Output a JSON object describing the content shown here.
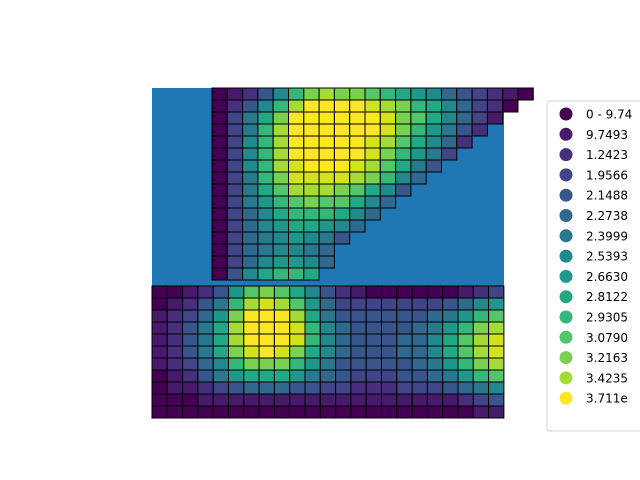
{
  "colors": {
    "background_fill": "#1f77b4",
    "cell_edge": "#000000",
    "palette": [
      "#440154",
      "#481a6c",
      "#472f7d",
      "#414487",
      "#39568c",
      "#31688e",
      "#2a788e",
      "#23888e",
      "#1f988b",
      "#22a884",
      "#35b779",
      "#54c568",
      "#7ad151",
      "#a5db36",
      "#d2e21b",
      "#fde725"
    ]
  },
  "chart_data": {
    "type": "heatmap",
    "title": "",
    "xlabel": "",
    "ylabel": "",
    "grid": false,
    "axes_visible": false,
    "legend_position": "right",
    "legend": [
      {
        "label": "0 - 9.74",
        "class": 0
      },
      {
        "label": "9.7493",
        "class": 1
      },
      {
        "label": "1.2423",
        "class": 2
      },
      {
        "label": "1.9566",
        "class": 3
      },
      {
        "label": "2.1488",
        "class": 4
      },
      {
        "label": "2.2738",
        "class": 5
      },
      {
        "label": "2.3999",
        "class": 6
      },
      {
        "label": "2.5393",
        "class": 7
      },
      {
        "label": "2.6630",
        "class": 8
      },
      {
        "label": "2.8122",
        "class": 9
      },
      {
        "label": "2.9305",
        "class": 10
      },
      {
        "label": "3.0790",
        "class": 11
      },
      {
        "label": "3.2163",
        "class": 12
      },
      {
        "label": "3.4235",
        "class": 13
      },
      {
        "label": "3.711e",
        "class": 15
      }
    ],
    "grid_columns": 23,
    "grid_rows": 20,
    "notes": "Cells are square grid elements colored by class index 0-15; upper wedge occupies columns 4 to right diagonal edge, lower bar spans full width.",
    "upper_rows": [
      [
        0,
        1,
        2,
        4,
        7,
        10,
        12,
        13,
        12,
        12,
        11,
        10,
        9,
        8,
        7,
        5,
        4,
        3,
        2,
        1,
        0
      ],
      [
        0,
        2,
        4,
        7,
        10,
        13,
        15,
        15,
        15,
        15,
        14,
        13,
        12,
        10,
        9,
        7,
        5,
        3,
        2,
        0
      ],
      [
        0,
        3,
        6,
        9,
        12,
        15,
        15,
        15,
        15,
        15,
        15,
        14,
        12,
        11,
        9,
        7,
        5,
        3,
        1
      ],
      [
        0,
        3,
        6,
        10,
        13,
        15,
        15,
        15,
        15,
        15,
        15,
        14,
        12,
        10,
        8,
        6,
        4,
        2
      ],
      [
        0,
        3,
        7,
        10,
        13,
        15,
        15,
        15,
        15,
        15,
        14,
        13,
        11,
        9,
        7,
        5,
        2
      ],
      [
        0,
        3,
        7,
        10,
        13,
        15,
        15,
        15,
        15,
        15,
        14,
        12,
        10,
        8,
        6,
        3
      ],
      [
        0,
        3,
        7,
        10,
        13,
        14,
        15,
        15,
        15,
        14,
        13,
        11,
        9,
        6,
        4
      ],
      [
        0,
        3,
        6,
        10,
        12,
        14,
        14,
        14,
        14,
        13,
        12,
        10,
        7,
        5
      ],
      [
        0,
        3,
        6,
        9,
        11,
        13,
        13,
        13,
        12,
        11,
        9,
        7,
        4
      ],
      [
        0,
        3,
        6,
        8,
        10,
        11,
        12,
        11,
        11,
        9,
        7,
        5
      ],
      [
        0,
        3,
        5,
        7,
        9,
        10,
        10,
        10,
        9,
        7,
        5
      ],
      [
        0,
        3,
        5,
        7,
        8,
        9,
        9,
        8,
        7,
        5
      ],
      [
        0,
        3,
        5,
        6,
        7,
        8,
        7,
        6,
        4
      ],
      [
        0,
        3,
        5,
        6,
        7,
        7,
        6,
        5
      ],
      [
        0,
        3,
        5,
        7,
        8,
        8,
        7,
        5
      ],
      [
        0,
        4,
        7,
        9,
        10,
        10,
        9
      ]
    ],
    "lower_rows": [
      [
        0,
        0,
        1,
        2,
        4,
        8,
        11,
        12,
        11,
        9,
        7,
        4,
        2,
        1,
        0,
        0,
        0,
        0,
        0,
        0,
        1,
        2,
        3
      ],
      [
        0,
        1,
        2,
        4,
        6,
        10,
        13,
        14,
        13,
        11,
        8,
        5,
        3,
        3,
        3,
        3,
        3,
        3,
        3,
        4,
        5,
        7,
        8
      ],
      [
        1,
        2,
        3,
        5,
        8,
        12,
        15,
        15,
        15,
        13,
        9,
        6,
        4,
        4,
        4,
        4,
        4,
        4,
        5,
        6,
        8,
        10,
        11
      ],
      [
        1,
        2,
        4,
        6,
        9,
        13,
        15,
        15,
        15,
        14,
        10,
        7,
        5,
        4,
        4,
        4,
        4,
        5,
        6,
        8,
        10,
        12,
        13
      ],
      [
        1,
        2,
        4,
        6,
        9,
        13,
        15,
        15,
        15,
        14,
        10,
        7,
        5,
        4,
        4,
        4,
        5,
        5,
        7,
        9,
        11,
        13,
        14
      ],
      [
        1,
        2,
        4,
        6,
        9,
        12,
        14,
        15,
        14,
        12,
        9,
        7,
        5,
        4,
        4,
        4,
        5,
        5,
        7,
        9,
        11,
        13,
        14
      ],
      [
        1,
        2,
        3,
        5,
        7,
        10,
        12,
        12,
        12,
        10,
        8,
        6,
        4,
        4,
        4,
        4,
        4,
        5,
        6,
        8,
        10,
        12,
        13
      ],
      [
        0,
        1,
        2,
        4,
        6,
        8,
        9,
        9,
        9,
        8,
        6,
        5,
        4,
        3,
        3,
        3,
        4,
        4,
        5,
        6,
        8,
        10,
        11
      ],
      [
        0,
        1,
        1,
        2,
        3,
        4,
        5,
        5,
        5,
        4,
        4,
        3,
        3,
        2,
        2,
        2,
        3,
        3,
        3,
        4,
        5,
        6,
        7
      ],
      [
        0,
        0,
        0,
        1,
        1,
        1,
        1,
        1,
        1,
        1,
        1,
        1,
        1,
        1,
        1,
        1,
        1,
        1,
        1,
        1,
        2,
        3,
        4
      ],
      [
        0,
        0,
        0,
        0,
        0,
        0,
        0,
        0,
        0,
        0,
        0,
        0,
        0,
        0,
        0,
        0,
        0,
        0,
        0,
        0,
        0,
        1,
        1
      ]
    ]
  }
}
